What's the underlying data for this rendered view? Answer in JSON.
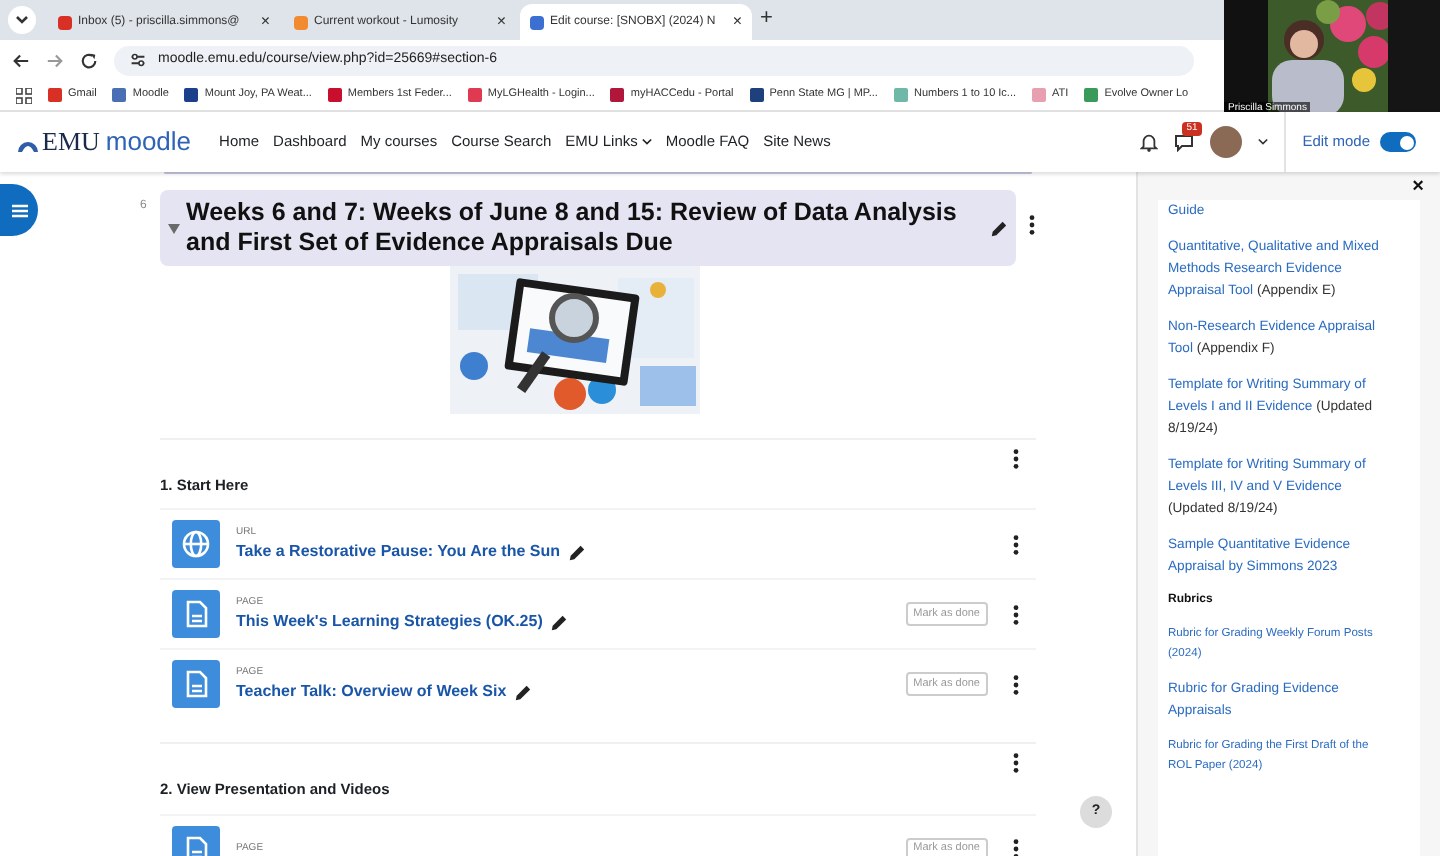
{
  "browser": {
    "tabs": [
      {
        "label": "Inbox (5) - priscilla.simmons@",
        "color": "#d93025",
        "close": "×",
        "selected": false
      },
      {
        "label": "Current workout - Lumosity",
        "color": "#f28b30",
        "close": "×",
        "selected": false
      },
      {
        "label": "Edit course: [SNOBX] (2024) N",
        "color": "#3b6fd1",
        "close": "×",
        "selected": true
      }
    ],
    "new_tab": "+",
    "url": "moodle.emu.edu/course/view.php?id=25669#section-6",
    "bookmarks": [
      {
        "label": "Gmail",
        "color": "#d93025"
      },
      {
        "label": "Moodle",
        "color": "#4a6fb5"
      },
      {
        "label": "Mount Joy, PA Weat...",
        "color": "#1c3f8c"
      },
      {
        "label": "Members 1st Feder...",
        "color": "#c8102e"
      },
      {
        "label": "MyLGHealth - Login...",
        "color": "#e03a52"
      },
      {
        "label": "myHACCedu - Portal",
        "color": "#b0173a"
      },
      {
        "label": "Penn State MG | MP...",
        "color": "#1e407c"
      },
      {
        "label": "Numbers 1 to 10 Ic...",
        "color": "#6fb8a8"
      },
      {
        "label": "ATI",
        "color": "#e8a0b0"
      },
      {
        "label": "Evolve Owner Lo",
        "color": "#3a9a5a"
      }
    ]
  },
  "video": {
    "name": "Priscilla Simmons"
  },
  "navbar": {
    "logo_mark": "EMU",
    "logo_word": "moodle",
    "links": [
      {
        "label": "Home",
        "caret": false
      },
      {
        "label": "Dashboard",
        "caret": false
      },
      {
        "label": "My courses",
        "caret": false
      },
      {
        "label": "Course Search",
        "caret": false
      },
      {
        "label": "EMU Links",
        "caret": true
      },
      {
        "label": "Moodle FAQ",
        "caret": false
      },
      {
        "label": "Site News",
        "caret": false
      }
    ],
    "badge": "51",
    "edit_mode": {
      "label": "Edit mode",
      "on": true
    }
  },
  "section": {
    "number": "6",
    "title": "Weeks 6 and 7: Weeks of June 8 and 15: Review of Data Analysis and First Set of Evidence Appraisals Due",
    "expanded": true,
    "subsections": [
      {
        "title": "1. Start Here",
        "activities": [
          {
            "kind": "url",
            "type": "URL",
            "title": "Take a Restorative Pause: You Are the Sun"
          },
          {
            "kind": "page",
            "type": "PAGE",
            "title": "This Week's Learning Strategies (OK.25)",
            "completion": "Mark as done"
          },
          {
            "kind": "page",
            "type": "PAGE",
            "title": "Teacher Talk: Overview of Week Six",
            "completion": "Mark as done"
          }
        ]
      },
      {
        "title": "2. View Presentation and Videos",
        "activities": [
          {
            "kind": "page",
            "type": "PAGE",
            "completion": "Mark as done"
          }
        ]
      }
    ]
  },
  "drawer": {
    "close": "×",
    "items": [
      {
        "kind": "link",
        "link": "Guide"
      },
      {
        "kind": "link",
        "link": "Quantitative, Qualitative and Mixed Methods Research Evidence Appraisal Tool",
        "note": "(Appendix E)"
      },
      {
        "kind": "link",
        "link": "Non-Research Evidence Appraisal Tool",
        "note": "(Appendix F)"
      },
      {
        "kind": "link",
        "link": "Template for Writing Summary of Levels I and II Evidence",
        "note": "(Updated 8/19/24)"
      },
      {
        "kind": "link",
        "link": "Template for Writing Summary of Levels III, IV and V Evidence",
        "note": "(Updated 8/19/24)"
      },
      {
        "kind": "link",
        "link": "Sample Quantitative Evidence Appraisal by Simmons 2023"
      },
      {
        "kind": "heading",
        "link": "Rubrics"
      },
      {
        "kind": "small",
        "link": "Rubric for Grading Weekly Forum Posts (2024)"
      },
      {
        "kind": "link",
        "link": "Rubric for Grading Evidence Appraisals"
      },
      {
        "kind": "small",
        "link": "Rubric for Grading the First Draft of the ROL Paper (2024)"
      }
    ]
  },
  "help": "?"
}
